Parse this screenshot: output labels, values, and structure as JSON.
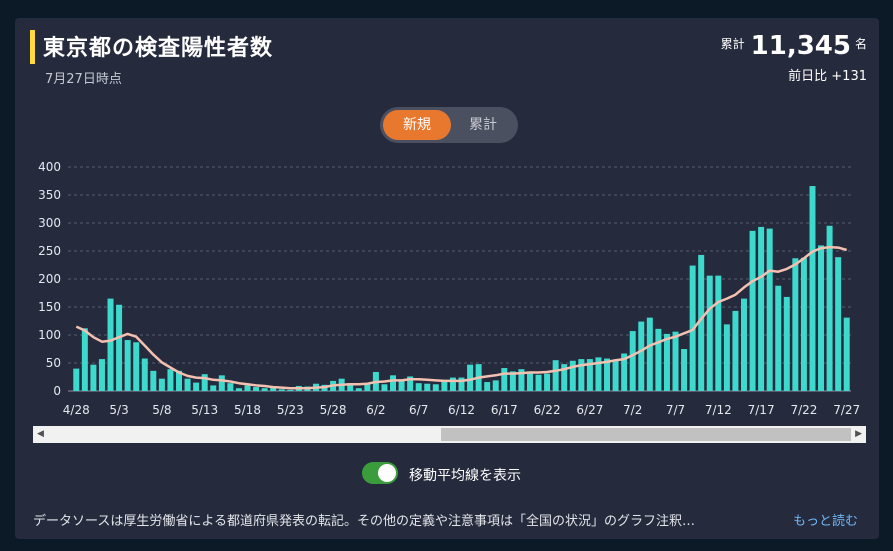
{
  "header": {
    "title": "東京都の検査陽性者数",
    "as_of": "7月27日時点",
    "total_label": "累計",
    "total_value": "11,345",
    "total_unit": "名",
    "delta": "前日比 +131"
  },
  "toggle": {
    "new_label": "新規",
    "cumulative_label": "累計",
    "selected": "new"
  },
  "moving_average": {
    "label": "移動平均線を表示",
    "enabled": true
  },
  "footer": {
    "note": "データソースは厚生労働省による都道府県発表の転記。その他の定義や注意事項は「全国の状況」のグラフ注釈…",
    "more_link": "もっと読む"
  },
  "colors": {
    "bar": "#3dd9cd",
    "line": "#f4c0b0",
    "accent": "#e8782d",
    "title_bar": "#ffd940",
    "background": "#252a3d"
  },
  "chart_data": {
    "type": "bar",
    "ylim": [
      0,
      400
    ],
    "y_ticks": [
      0,
      50,
      100,
      150,
      200,
      250,
      300,
      350,
      400
    ],
    "x_tick_labels": [
      "4/28",
      "5/3",
      "5/8",
      "5/13",
      "5/18",
      "5/23",
      "5/28",
      "6/2",
      "6/7",
      "6/12",
      "6/17",
      "6/22",
      "6/27",
      "7/2",
      "7/7",
      "7/12",
      "7/17",
      "7/22",
      "7/27"
    ],
    "grid": true,
    "categories": [
      "4/28",
      "4/29",
      "4/30",
      "5/1",
      "5/2",
      "5/3",
      "5/4",
      "5/5",
      "5/6",
      "5/7",
      "5/8",
      "5/9",
      "5/10",
      "5/11",
      "5/12",
      "5/13",
      "5/14",
      "5/15",
      "5/16",
      "5/17",
      "5/18",
      "5/19",
      "5/20",
      "5/21",
      "5/22",
      "5/23",
      "5/24",
      "5/25",
      "5/26",
      "5/27",
      "5/28",
      "5/29",
      "5/30",
      "5/31",
      "6/1",
      "6/2",
      "6/3",
      "6/4",
      "6/5",
      "6/6",
      "6/7",
      "6/8",
      "6/9",
      "6/10",
      "6/11",
      "6/12",
      "6/13",
      "6/14",
      "6/15",
      "6/16",
      "6/17",
      "6/18",
      "6/19",
      "6/20",
      "6/21",
      "6/22",
      "6/23",
      "6/24",
      "6/25",
      "6/26",
      "6/27",
      "6/28",
      "6/29",
      "6/30",
      "7/1",
      "7/2",
      "7/3",
      "7/4",
      "7/5",
      "7/6",
      "7/7",
      "7/8",
      "7/9",
      "7/10",
      "7/11",
      "7/12",
      "7/13",
      "7/14",
      "7/15",
      "7/16",
      "7/17",
      "7/18",
      "7/19",
      "7/20",
      "7/21",
      "7/22",
      "7/23",
      "7/24",
      "7/25",
      "7/26",
      "7/27"
    ],
    "series": [
      {
        "values": [
          40,
          112,
          47,
          57,
          165,
          154,
          91,
          87,
          58,
          36,
          22,
          39,
          36,
          22,
          15,
          30,
          10,
          28,
          14,
          5,
          10,
          7,
          5,
          7,
          3,
          2,
          9,
          8,
          13,
          11,
          18,
          22,
          14,
          5,
          13,
          34,
          12,
          28,
          20,
          26,
          14,
          13,
          12,
          19,
          24,
          24,
          47,
          48,
          16,
          19,
          41,
          35,
          39,
          35,
          29,
          31,
          55,
          48,
          54,
          57,
          57,
          60,
          58,
          54,
          67,
          107,
          124,
          131,
          111,
          102,
          106,
          75,
          224,
          243,
          206,
          206,
          119,
          143,
          165,
          286,
          293,
          290,
          188,
          168,
          237,
          238,
          366,
          260,
          295,
          239,
          131
        ]
      },
      {
        "values": [
          115,
          108,
          96,
          88,
          90,
          96,
          102,
          97,
          81,
          65,
          51,
          42,
          33,
          27,
          24,
          23,
          20,
          19,
          17,
          14,
          12,
          10,
          9,
          7,
          6,
          5,
          5,
          5,
          6,
          7,
          10,
          11,
          12,
          12,
          13,
          16,
          17,
          19,
          19,
          21,
          21,
          20,
          19,
          18,
          18,
          18,
          20,
          24,
          26,
          28,
          31,
          31,
          32,
          33,
          33,
          34,
          36,
          39,
          43,
          46,
          48,
          50,
          52,
          55,
          57,
          64,
          72,
          81,
          87,
          93,
          97,
          103,
          109,
          129,
          147,
          159,
          165,
          172,
          185,
          196,
          204,
          215,
          213,
          218,
          226,
          237,
          249,
          255,
          257,
          256,
          252
        ]
      }
    ]
  }
}
